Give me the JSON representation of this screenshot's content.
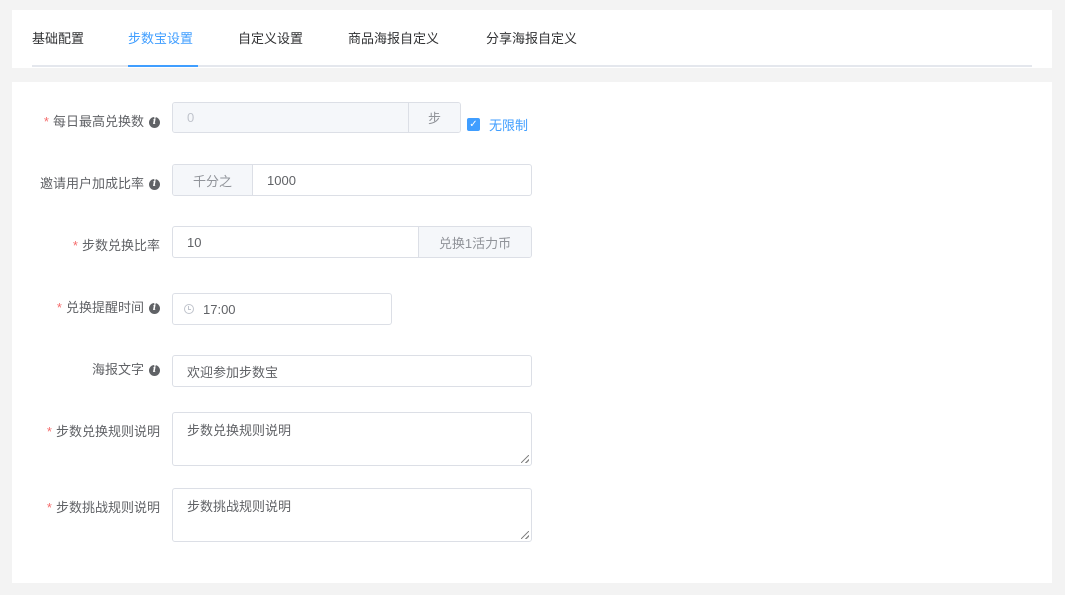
{
  "tabs": [
    {
      "label": "基础配置"
    },
    {
      "label": "步数宝设置"
    },
    {
      "label": "自定义设置"
    },
    {
      "label": "商品海报自定义"
    },
    {
      "label": "分享海报自定义"
    }
  ],
  "active_tab_index": 1,
  "accent_color": "#409eff",
  "required_color": "#f56c6c",
  "form": {
    "daily_max": {
      "label": "每日最高兑换数",
      "required": true,
      "value": "0",
      "suffix": "步",
      "disabled": true,
      "unlimited_label": "无限制",
      "unlimited_checked": true
    },
    "invite_rate": {
      "label": "邀请用户加成比率",
      "required": false,
      "prefix": "千分之",
      "value": "1000"
    },
    "exchange_rate": {
      "label": "步数兑换比率",
      "required": true,
      "value": "10",
      "suffix": "兑换1活力币"
    },
    "remind_time": {
      "label": "兑换提醒时间",
      "required": true,
      "value": "17:00",
      "icon": "clock-icon"
    },
    "poster_text": {
      "label": "海报文字",
      "required": false,
      "value": "欢迎参加步数宝"
    },
    "exchange_rules": {
      "label": "步数兑换规则说明",
      "required": true,
      "value": "步数兑换规则说明"
    },
    "challenge_rules": {
      "label": "步数挑战规则说明",
      "required": true,
      "value": "步数挑战规则说明"
    }
  }
}
